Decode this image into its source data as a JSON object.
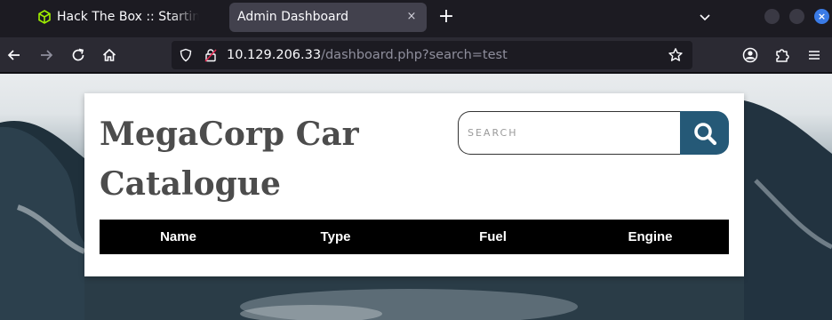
{
  "browser": {
    "tabs": [
      {
        "title": "Hack The Box :: Starting Point",
        "active": false,
        "icon": "htb-cube-icon"
      },
      {
        "title": "Admin Dashboard",
        "active": true
      }
    ],
    "close_glyph": "×",
    "new_tab_glyph": "+",
    "url": {
      "host": "10.129.206.33",
      "path": "/dashboard.php?search=test"
    }
  },
  "page": {
    "title": "MegaCorp Car Catalogue",
    "search": {
      "placeholder": "SEARCH",
      "value": ""
    },
    "table": {
      "columns": [
        "Name",
        "Type",
        "Fuel",
        "Engine"
      ]
    }
  },
  "colors": {
    "browser_bg": "#1c1b22",
    "toolbar_bg": "#2b2a33",
    "active_tab_bg": "#42414d",
    "search_button": "#255977",
    "htb_green": "#9fef00",
    "table_header_bg": "#000000"
  }
}
